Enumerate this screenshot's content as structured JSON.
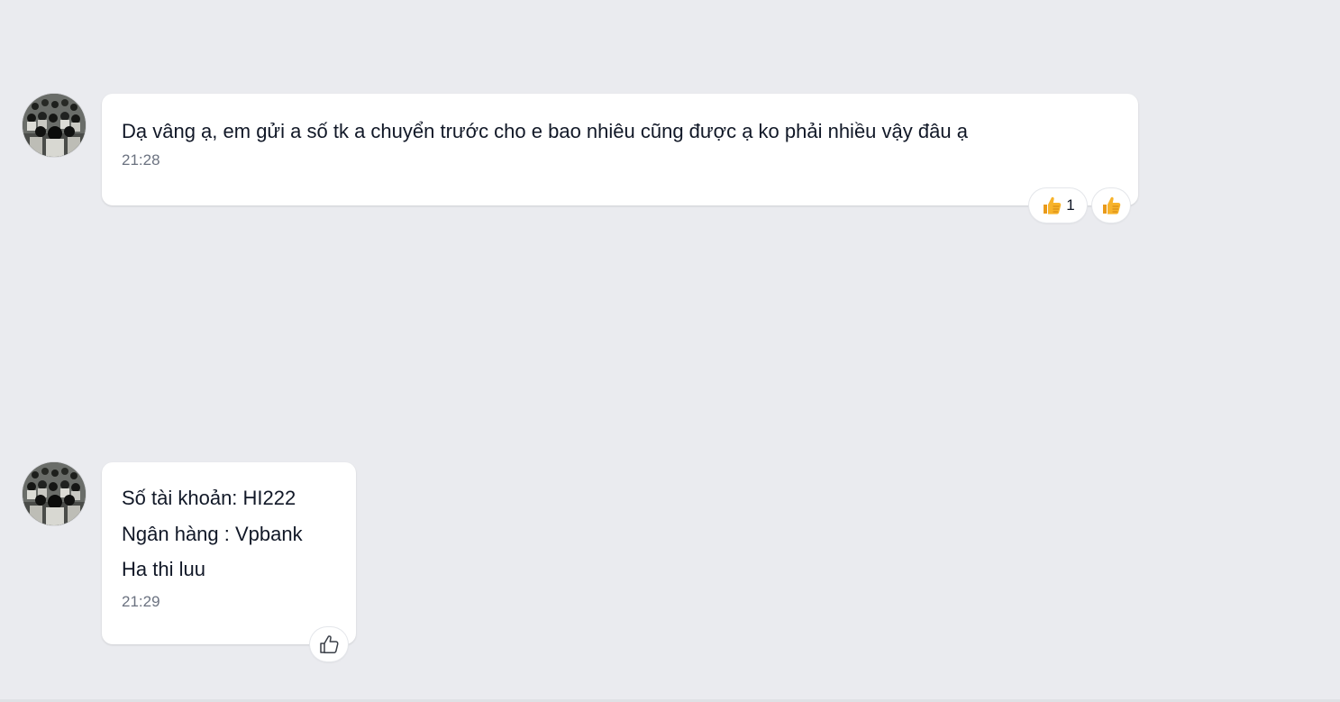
{
  "messages": [
    {
      "text": "Dạ vâng ạ, em gửi a số tk a chuyển trước cho e bao nhiêu cũng được ạ ko phải nhiều vậy đâu ạ",
      "time": "21:28",
      "reactions": [
        {
          "icon": "thumbs-up-emoji",
          "count": "1"
        },
        {
          "icon": "thumbs-up-emoji"
        }
      ]
    },
    {
      "text": "Số tài khoản: HI222\nNgân hàng : Vpbank\nHa thi luu",
      "time": "21:29",
      "reactions": [
        {
          "icon": "thumbs-up-outline-icon"
        }
      ]
    }
  ],
  "colors": {
    "background": "#eaebef",
    "bubble": "#ffffff",
    "text": "#111827",
    "time": "#6b7280",
    "emoji_yellow": "#f7b32b"
  }
}
